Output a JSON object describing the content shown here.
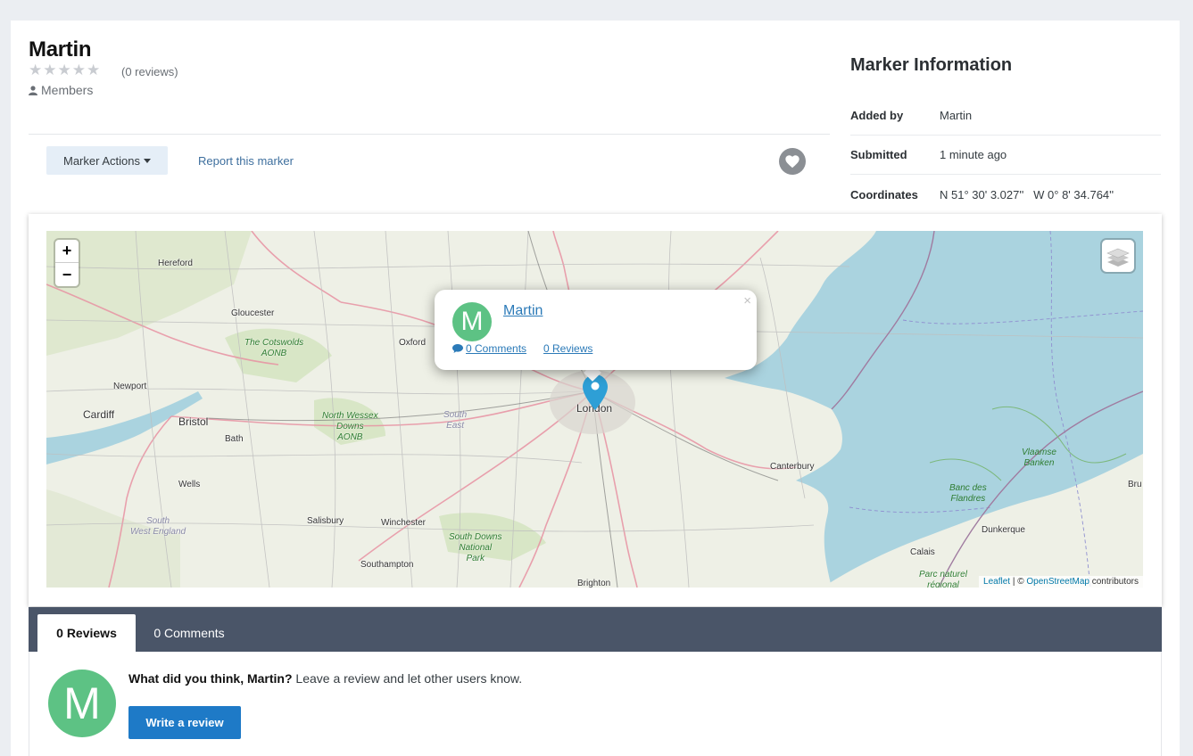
{
  "marker": {
    "title": "Martin",
    "review_count": "(0 reviews)",
    "group": "Members",
    "rating": 0,
    "max_rating": 5
  },
  "actions": {
    "marker_actions_label": "Marker Actions",
    "report_label": "Report this marker"
  },
  "info": {
    "title": "Marker Information",
    "rows": [
      {
        "label": "Added by",
        "value": "Martin"
      },
      {
        "label": "Submitted",
        "value": "1 minute ago"
      },
      {
        "label": "Coordinates",
        "value": "N 51° 30' 3.027''   W 0° 8' 34.764''"
      }
    ]
  },
  "map": {
    "zoom_in": "+",
    "zoom_out": "−",
    "attribution_leaflet": "Leaflet",
    "attribution_sep": " | © ",
    "attribution_osm": "OpenStreetMap",
    "attribution_suffix": " contributors",
    "places": {
      "hereford": "Hereford",
      "gloucester": "Gloucester",
      "oxford": "Oxford",
      "newport": "Newport",
      "cardiff": "Cardiff",
      "bristol": "Bristol",
      "bath": "Bath",
      "wells": "Wells",
      "salisbury": "Salisbury",
      "winchester": "Winchester",
      "southampton": "Southampton",
      "brighton": "Brighton",
      "london": "London",
      "canterbury": "Canterbury",
      "dunkerque": "Dunkerque",
      "calais": "Calais",
      "brugge": "Bru",
      "south_east_1": "South",
      "south_east_2": "East",
      "sw_england_1": "South",
      "sw_england_2": "West England",
      "cotswolds_1": "The Cotswolds",
      "cotswolds_2": "AONB",
      "wessex_1": "North Wessex",
      "wessex_2": "Downs",
      "wessex_3": "AONB",
      "sdowns_1": "South Downs",
      "sdowns_2": "National",
      "sdowns_3": "Park",
      "vlaamse_1": "Vlaamse",
      "vlaamse_2": "Banken",
      "flandres_1": "Banc des",
      "flandres_2": "Flandres",
      "parc_1": "Parc naturel",
      "parc_2": "régional"
    },
    "popup": {
      "avatar_letter": "M",
      "name": "Martin",
      "comments": "0 Comments",
      "reviews": "0 Reviews",
      "close": "×"
    }
  },
  "tabs": [
    {
      "label": "0 Reviews",
      "active": true
    },
    {
      "label": "0 Comments",
      "active": false
    }
  ],
  "review_prompt": {
    "avatar_letter": "M",
    "question": "What did you think, Martin?",
    "text": " Leave a review and let other users know.",
    "button": "Write a review"
  },
  "colors": {
    "accent": "#1e7ac7",
    "avatar": "#5dc284",
    "tab_bar": "#4a5568",
    "link": "#2b7ab8",
    "sea": "#aad3df"
  }
}
